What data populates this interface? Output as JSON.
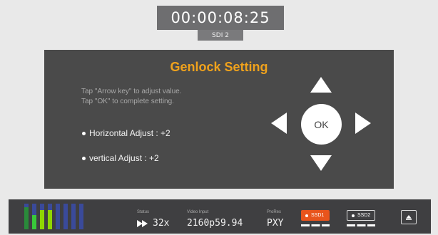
{
  "timecode": {
    "value": "00:00:08:25",
    "source": "SDI 2"
  },
  "dialog": {
    "title": "Genlock Setting",
    "instruction_1": "Tap \"Arrow key\" to adjust value.",
    "instruction_2": "Tap \"OK\" to complete setting.",
    "horizontal_adjust": "Horizontal Adjust : +2",
    "vertical_adjust": "vertical  Adjust : +2",
    "ok_label": "OK"
  },
  "statusbar": {
    "status_label": "Status",
    "status_value": "32x",
    "video_input_label": "Video Input",
    "video_input_value": "2160p59.94",
    "prores_label": "ProRes",
    "prores_value": "PXY",
    "ssd1_label": "SSD1",
    "ssd2_label": "SSD2"
  },
  "audio_meters": {
    "levels": [
      0.85,
      0.55,
      0.75,
      0.75,
      0,
      0,
      0,
      0
    ],
    "fill_colors": [
      "#2a8a3a",
      "#38c93a",
      "#8fd600",
      "#8fd600",
      "#3a4a9a",
      "#3a4a9a",
      "#3a4a9a",
      "#3a4a9a"
    ]
  },
  "colors": {
    "accent": "#f0a21c",
    "record_orange": "#e8541c",
    "dialog_bg": "#4a4a4a"
  }
}
